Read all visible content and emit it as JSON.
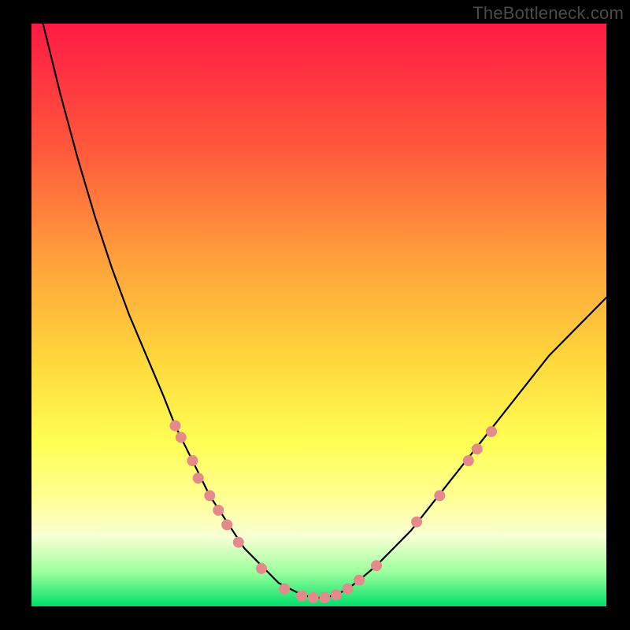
{
  "watermark": "TheBottleneck.com",
  "chart_data": {
    "type": "line",
    "title": "",
    "xlabel": "",
    "ylabel": "",
    "xlim": [
      0,
      100
    ],
    "ylim": [
      0,
      100
    ],
    "gradient_stops": [
      {
        "pos": 0,
        "color": "#ff1a44"
      },
      {
        "pos": 22,
        "color": "#ff5a3c"
      },
      {
        "pos": 42,
        "color": "#ffa63c"
      },
      {
        "pos": 58,
        "color": "#ffd83c"
      },
      {
        "pos": 72,
        "color": "#ffff55"
      },
      {
        "pos": 82,
        "color": "#ffff99"
      },
      {
        "pos": 88,
        "color": "#f8ffd4"
      },
      {
        "pos": 94,
        "color": "#9eff9e"
      },
      {
        "pos": 100,
        "color": "#00e06a"
      }
    ],
    "series": [
      {
        "name": "bottleneck-curve",
        "stroke": "#000000",
        "x": [
          2,
          5,
          8,
          11,
          14,
          17,
          20,
          23,
          25,
          27,
          29,
          31,
          33,
          35,
          37,
          39,
          41,
          43,
          45,
          47,
          49,
          51,
          53,
          55,
          57,
          60,
          63,
          66,
          70,
          74,
          78,
          82,
          86,
          90,
          94,
          98,
          100
        ],
        "y": [
          100,
          88,
          77,
          67,
          58,
          50,
          43,
          36,
          31,
          27,
          23,
          19,
          16,
          13,
          10,
          8,
          6,
          4,
          3,
          2,
          1.5,
          1.5,
          2,
          3,
          4.5,
          7,
          10,
          13,
          18,
          23,
          28,
          33,
          38,
          43,
          47,
          51,
          53
        ]
      }
    ],
    "markers": {
      "color": "#e48a8a",
      "radius_px": 7,
      "points": [
        {
          "x": 25,
          "y": 31
        },
        {
          "x": 26,
          "y": 29
        },
        {
          "x": 28,
          "y": 25
        },
        {
          "x": 29,
          "y": 22
        },
        {
          "x": 31,
          "y": 19
        },
        {
          "x": 32.5,
          "y": 16.5
        },
        {
          "x": 34,
          "y": 14
        },
        {
          "x": 36,
          "y": 11
        },
        {
          "x": 40,
          "y": 6.5
        },
        {
          "x": 44,
          "y": 3
        },
        {
          "x": 47,
          "y": 1.8
        },
        {
          "x": 49,
          "y": 1.5
        },
        {
          "x": 51,
          "y": 1.5
        },
        {
          "x": 53,
          "y": 2
        },
        {
          "x": 55,
          "y": 3
        },
        {
          "x": 57,
          "y": 4.5
        },
        {
          "x": 60,
          "y": 7
        },
        {
          "x": 67,
          "y": 14.5
        },
        {
          "x": 71,
          "y": 19
        },
        {
          "x": 76,
          "y": 25
        },
        {
          "x": 77.5,
          "y": 27
        },
        {
          "x": 80,
          "y": 30
        }
      ]
    }
  }
}
